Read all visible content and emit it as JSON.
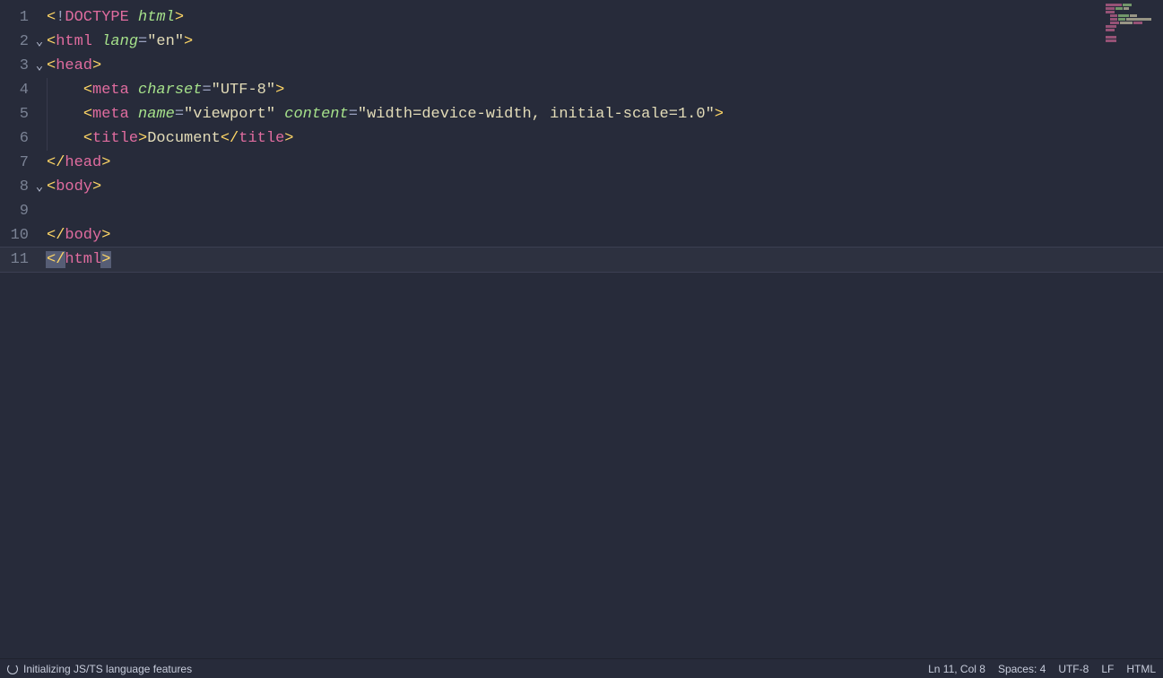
{
  "editor": {
    "lines": [
      {
        "n": "1",
        "foldable": false
      },
      {
        "n": "2",
        "foldable": true
      },
      {
        "n": "3",
        "foldable": true
      },
      {
        "n": "4",
        "foldable": false
      },
      {
        "n": "5",
        "foldable": false
      },
      {
        "n": "6",
        "foldable": false
      },
      {
        "n": "7",
        "foldable": false
      },
      {
        "n": "8",
        "foldable": true
      },
      {
        "n": "9",
        "foldable": false
      },
      {
        "n": "10",
        "foldable": false
      },
      {
        "n": "11",
        "foldable": false
      }
    ],
    "tokens": {
      "lt": "<",
      "gt": ">",
      "ltslash": "</",
      "bang": "!",
      "eq": "=",
      "doctype": "DOCTYPE",
      "doctype_arg": "html",
      "tag_html": "html",
      "tag_head": "head",
      "tag_meta": "meta",
      "tag_title": "title",
      "tag_body": "body",
      "attr_lang": "lang",
      "attr_charset": "charset",
      "attr_name": "name",
      "attr_content": "content",
      "val_en": "\"en\"",
      "val_utf8": "\"UTF-8\"",
      "val_viewport": "\"viewport\"",
      "val_content": "\"width=device-width, initial-scale=1.0\"",
      "txt_document": "Document"
    },
    "cursor": {
      "line": 11,
      "col": 8
    }
  },
  "statusbar": {
    "init_msg": "Initializing JS/TS language features",
    "position": "Ln 11, Col 8",
    "spaces": "Spaces: 4",
    "encoding": "UTF-8",
    "eol": "LF",
    "language": "HTML"
  }
}
